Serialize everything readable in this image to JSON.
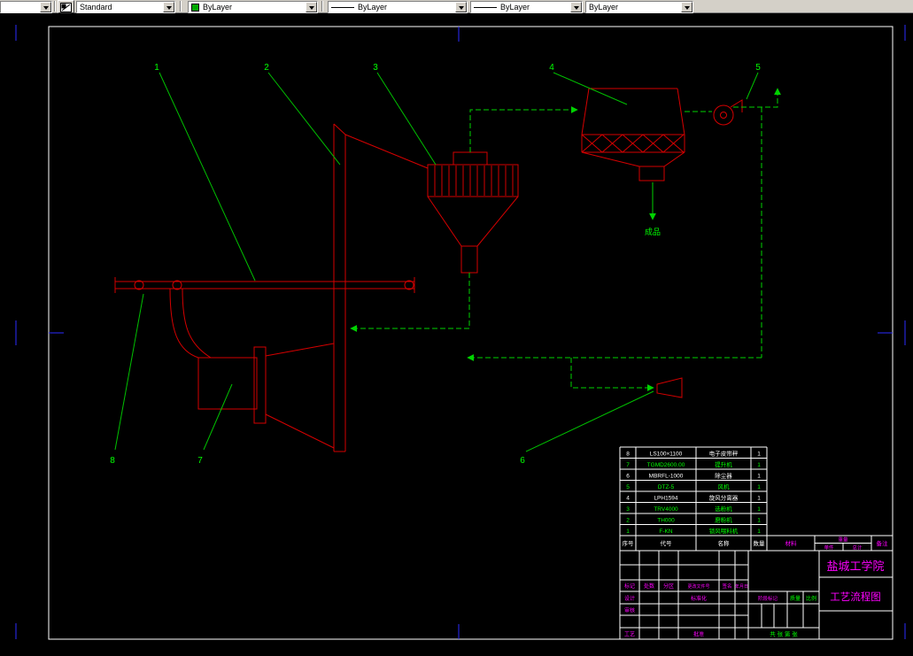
{
  "toolbar": {
    "layer_combo_value": "",
    "combos": [
      {
        "label": "Standard"
      },
      {
        "label": "ByLayer",
        "swatch": "#00a800"
      },
      {
        "label": "ByLayer"
      },
      {
        "label": "ByLayer"
      },
      {
        "label": "ByLayer"
      }
    ]
  },
  "diagram": {
    "callouts": [
      "1",
      "2",
      "3",
      "4",
      "5",
      "6",
      "7",
      "8"
    ],
    "product_label": "成品"
  },
  "parts_table": {
    "headers": {
      "no": "序号",
      "code": "代号",
      "name": "名称",
      "qty": "数量",
      "material": "材料",
      "weight": "重量",
      "unit": "单件",
      "total": "总计",
      "remark": "备注"
    },
    "rows": [
      {
        "no": "8",
        "code": "LS100×1100",
        "name": "电子皮带秤",
        "qty": "1",
        "color": "#ffffff"
      },
      {
        "no": "7",
        "code": "TGMD2600.00",
        "name": "提升机",
        "qty": "1",
        "color": "#00ff00"
      },
      {
        "no": "6",
        "code": "MBRFL-1000",
        "name": "除尘器",
        "qty": "1",
        "color": "#ffffff"
      },
      {
        "no": "5",
        "code": "DTZ-5",
        "name": "风机",
        "qty": "1",
        "color": "#00ff00"
      },
      {
        "no": "4",
        "code": "LPH1594",
        "name": "旋风分离器",
        "qty": "1",
        "color": "#ffffff"
      },
      {
        "no": "3",
        "code": "TRV4000",
        "name": "选粉机",
        "qty": "1",
        "color": "#00ff00"
      },
      {
        "no": "2",
        "code": "TH000",
        "name": "磨粉机",
        "qty": "1",
        "color": "#00ff00"
      },
      {
        "no": "1",
        "code": "F-KN",
        "name": "锁风喂料机",
        "qty": "1",
        "color": "#00ff00"
      }
    ]
  },
  "title_block": {
    "school": "盐城工学院",
    "drawing_title": "工艺流程图",
    "labels": {
      "mark": "标记",
      "count": "处数",
      "zone": "分区",
      "change_doc": "更改文件号",
      "sign": "签名",
      "date": "年月日",
      "design": "设计",
      "standardize": "标准化",
      "check": "审核",
      "process": "工艺",
      "approve": "批准",
      "stage_mark": "阶段标记",
      "mass": "质量",
      "scale": "比例",
      "sheets": "共 张 第 张"
    }
  }
}
